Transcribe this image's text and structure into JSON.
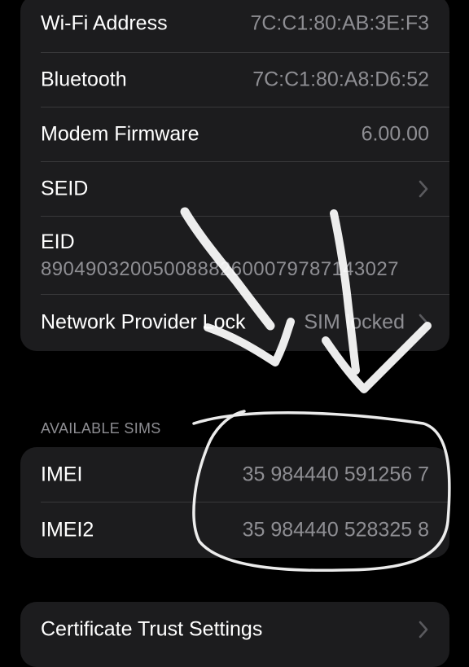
{
  "network_group": {
    "rows": [
      {
        "label": "Wi-Fi Address",
        "value": "7C:C1:80:AB:3E:F3"
      },
      {
        "label": "Bluetooth",
        "value": "7C:C1:80:A8:D6:52"
      },
      {
        "label": "Modem Firmware",
        "value": "6.00.00"
      },
      {
        "label": "SEID",
        "value": ""
      },
      {
        "label": "EID",
        "value": "89049032005008882600079787143027"
      },
      {
        "label": "Network Provider Lock",
        "value": "SIM locked"
      }
    ]
  },
  "available_sims": {
    "header": "AVAILABLE SIMS",
    "rows": [
      {
        "label": "IMEI",
        "value": "35 984440 591256 7"
      },
      {
        "label": "IMEI2",
        "value": "35 984440 528325 8"
      }
    ]
  },
  "trust_group": {
    "rows": [
      {
        "label": "Certificate Trust Settings"
      }
    ]
  },
  "icons": {
    "chevron": "chevron-right-icon"
  },
  "colors": {
    "background": "#000000",
    "cell_background": "#1c1c1e",
    "separator": "#38383a",
    "secondary_text": "#8e8e93",
    "annotation_stroke": "#ffffff"
  }
}
